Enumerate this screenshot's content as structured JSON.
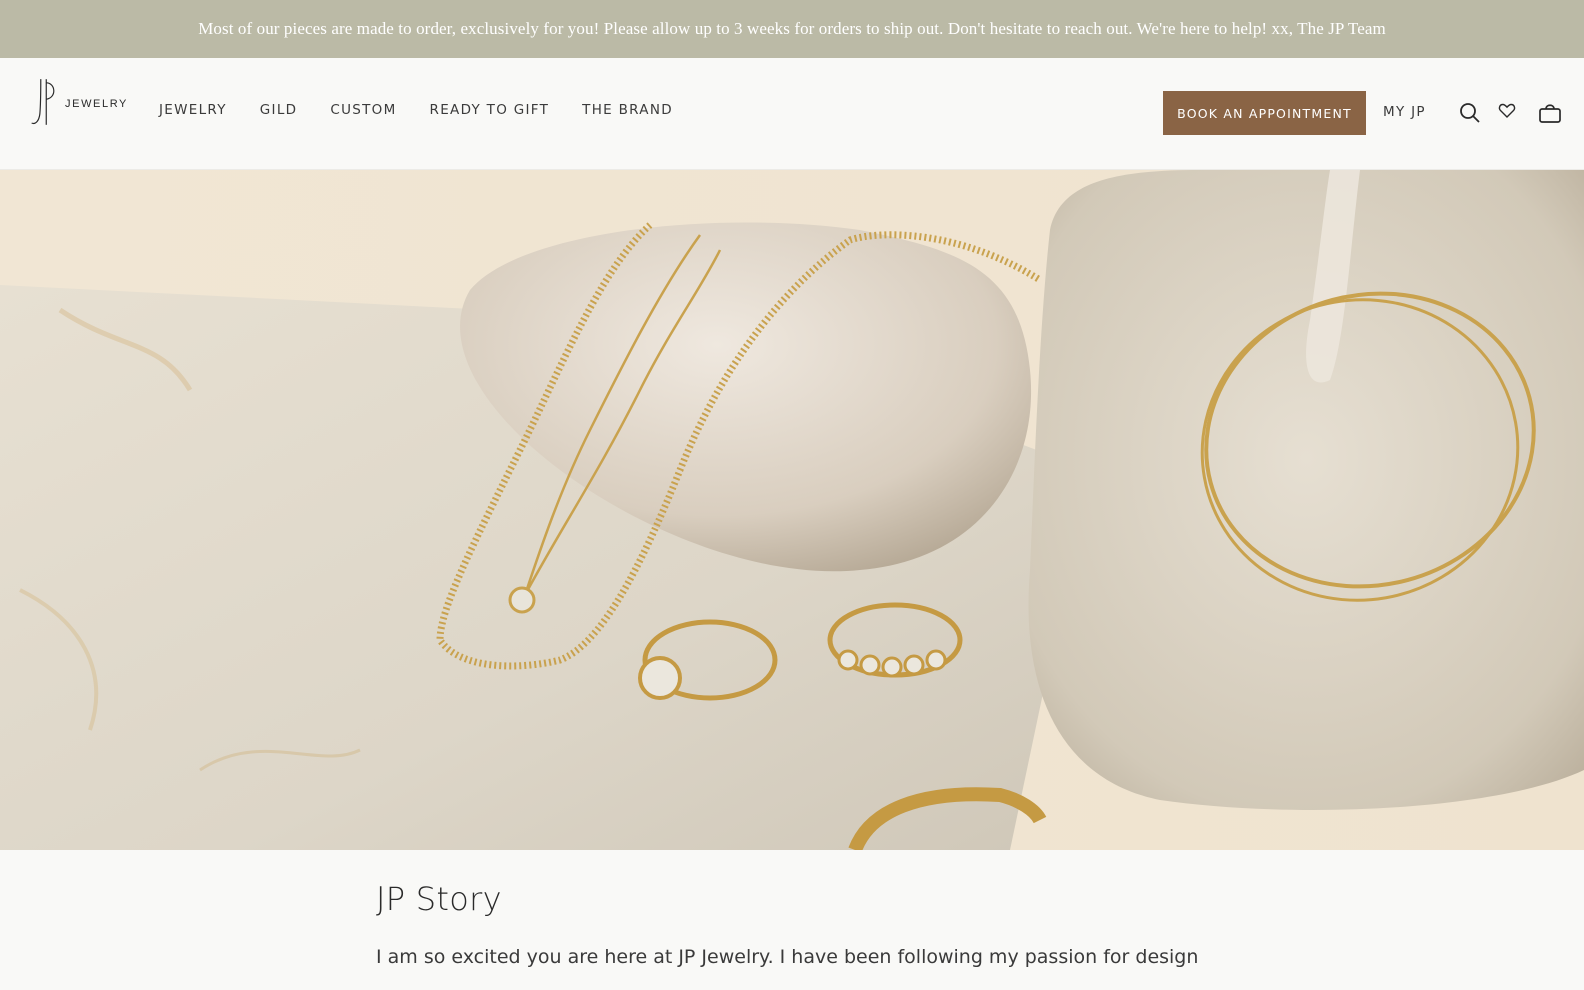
{
  "announcement": {
    "text": "Most of our pieces are made to order, exclusively for you! Please allow up to 3 weeks for orders to ship out. Don't hesitate to reach out. We're here to help! xx, The JP Team"
  },
  "header": {
    "logo_text": "JEWELRY",
    "nav": [
      {
        "label": "JEWELRY"
      },
      {
        "label": "GILD"
      },
      {
        "label": "CUSTOM"
      },
      {
        "label": "READY TO GIFT"
      },
      {
        "label": "THE BRAND"
      }
    ],
    "book_button": "BOOK AN APPOINTMENT",
    "account_link": "MY JP",
    "icons": [
      "search-icon",
      "heart-icon",
      "bag-icon"
    ]
  },
  "hero": {
    "image": "gold-jewelry-on-stone"
  },
  "story": {
    "title": "JP Story",
    "intro": "I am so excited you are here at JP Jewelry. I have been following my passion for design"
  },
  "colors": {
    "announcement_bg": "#bbbaa6",
    "button_bg": "#8a6445",
    "page_bg": "#f9f9f7"
  }
}
